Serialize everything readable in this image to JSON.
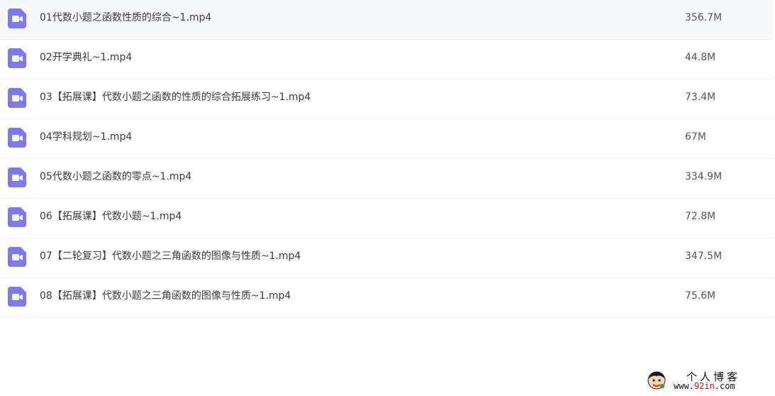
{
  "colors": {
    "icon_bg": "#7b78f0",
    "icon_fg": "#ffffff",
    "row_divider": "#f0f0f2",
    "watermark_accent": "#d11515"
  },
  "files": [
    {
      "name": "01代数小题之函数性质的综合~1.mp4",
      "size": "356.7M",
      "icon": "video-file-icon"
    },
    {
      "name": "02开学典礼~1.mp4",
      "size": "44.8M",
      "icon": "video-file-icon"
    },
    {
      "name": "03【拓展课】代数小题之函数的性质的综合拓展练习~1.mp4",
      "size": "73.4M",
      "icon": "video-file-icon"
    },
    {
      "name": "04学科规划~1.mp4",
      "size": "67M",
      "icon": "video-file-icon"
    },
    {
      "name": "05代数小题之函数的零点~1.mp4",
      "size": "334.9M",
      "icon": "video-file-icon"
    },
    {
      "name": "06【拓展课】代数小题~1.mp4",
      "size": "72.8M",
      "icon": "video-file-icon"
    },
    {
      "name": "07【二轮复习】代数小题之三角函数的图像与性质~1.mp4",
      "size": "347.5M",
      "icon": "video-file-icon"
    },
    {
      "name": "08【拓展课】代数小题之三角函数的图像与性质~1.mp4",
      "size": "75.6M",
      "icon": "video-file-icon"
    }
  ],
  "watermark": {
    "title": "个人博客",
    "url_prefix": "www.",
    "url_accent": "92in",
    "url_suffix": ".com"
  }
}
